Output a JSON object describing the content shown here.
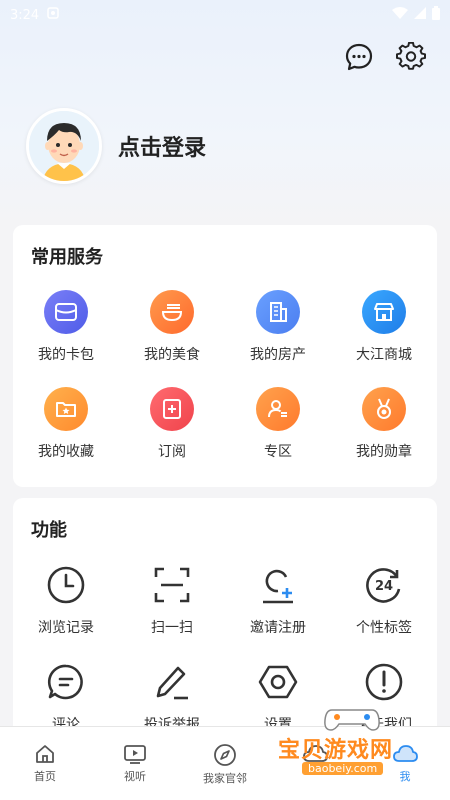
{
  "status_bar": {
    "time": "3:24"
  },
  "profile": {
    "login_label": "点击登录"
  },
  "services": {
    "title": "常用服务",
    "items": [
      {
        "label": "我的卡包",
        "icon": "wallet-icon",
        "color": "#5b6ef5"
      },
      {
        "label": "我的美食",
        "icon": "food-bowl-icon",
        "color": "#ff7a3d"
      },
      {
        "label": "我的房产",
        "icon": "building-icon",
        "color": "#5a8df5"
      },
      {
        "label": "大江商城",
        "icon": "store-icon",
        "color": "#2f86f0"
      },
      {
        "label": "我的收藏",
        "icon": "folder-star-icon",
        "color": "#ff9a3c"
      },
      {
        "label": "订阅",
        "icon": "subscribe-plus-icon",
        "color": "#f5525a"
      },
      {
        "label": "专区",
        "icon": "person-card-icon",
        "color": "#ff8a3c"
      },
      {
        "label": "我的勋章",
        "icon": "medal-icon",
        "color": "#ff8a3c"
      }
    ]
  },
  "functions": {
    "title": "功能",
    "items": [
      {
        "label": "浏览记录",
        "icon": "clock-icon"
      },
      {
        "label": "扫一扫",
        "icon": "scan-icon"
      },
      {
        "label": "邀请注册",
        "icon": "invite-user-icon"
      },
      {
        "label": "个性标签",
        "icon": "tag-24-icon"
      },
      {
        "label": "评论",
        "icon": "comment-icon"
      },
      {
        "label": "投诉举报",
        "icon": "pen-icon"
      },
      {
        "label": "设置",
        "icon": "hex-nut-icon"
      },
      {
        "label": "关于我们",
        "icon": "info-exclaim-icon"
      }
    ]
  },
  "tabbar": {
    "items": [
      {
        "label": "首页",
        "icon": "home-icon"
      },
      {
        "label": "视听",
        "icon": "tv-play-icon"
      },
      {
        "label": "我家官邻",
        "icon": "compass-icon"
      },
      {
        "label": "",
        "icon": "cloud-icon"
      },
      {
        "label": "我",
        "icon": "me-cloud-icon",
        "active": true
      }
    ]
  },
  "watermark": {
    "text": "宝贝游戏网",
    "url": "baobeiy.com"
  }
}
